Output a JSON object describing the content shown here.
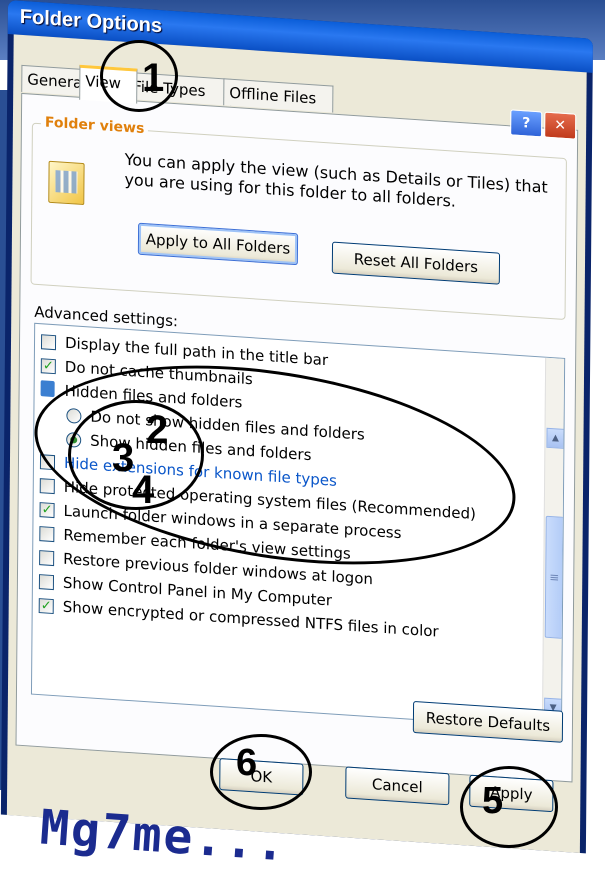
{
  "window": {
    "title": "Folder Options",
    "help": "?",
    "close": "✕"
  },
  "tabs": [
    {
      "label": "General"
    },
    {
      "label": "View"
    },
    {
      "label": "File Types"
    },
    {
      "label": "Offline Files"
    }
  ],
  "folder_views": {
    "legend": "Folder views",
    "text": "You can apply the view (such as Details or Tiles) that you are using for this folder to all folders.",
    "apply_all": "Apply to All Folders",
    "reset_all": "Reset All Folders"
  },
  "advanced": {
    "label": "Advanced settings:",
    "items": [
      {
        "text": "Display the full path in the title bar",
        "type": "checkbox",
        "checked": false
      },
      {
        "text": "Do not cache thumbnails",
        "type": "checkbox",
        "checked": true
      },
      {
        "text": "Hidden files and folders",
        "type": "folder"
      },
      {
        "text": "Do not show hidden files and folders",
        "type": "radio",
        "checked": false
      },
      {
        "text": "Show hidden files and folders",
        "type": "radio",
        "checked": true
      },
      {
        "text": "Hide extensions for known file types",
        "type": "checkbox",
        "checked": false
      },
      {
        "text": "Hide protected operating system files (Recommended)",
        "type": "checkbox",
        "checked": false
      },
      {
        "text": "Launch folder windows in a separate process",
        "type": "checkbox",
        "checked": true
      },
      {
        "text": "Remember each folder's view settings",
        "type": "checkbox",
        "checked": false
      },
      {
        "text": "Restore previous folder windows at logon",
        "type": "checkbox",
        "checked": false
      },
      {
        "text": "Show Control Panel in My Computer",
        "type": "checkbox",
        "checked": false
      },
      {
        "text": "Show encrypted or compressed NTFS files in color",
        "type": "checkbox",
        "checked": true
      }
    ],
    "restore_defaults": "Restore Defaults"
  },
  "buttons": {
    "ok": "OK",
    "cancel": "Cancel",
    "apply": "Apply"
  },
  "markers": {
    "m1": "1",
    "m2": "2",
    "m3": "3",
    "m4": "4",
    "m5": "5",
    "m6": "6"
  },
  "watermark": "Mg7me...",
  "icons": {
    "folder": "folder-icon",
    "scroll_up": "scroll-up-icon",
    "scroll_down": "scroll-down-icon"
  }
}
